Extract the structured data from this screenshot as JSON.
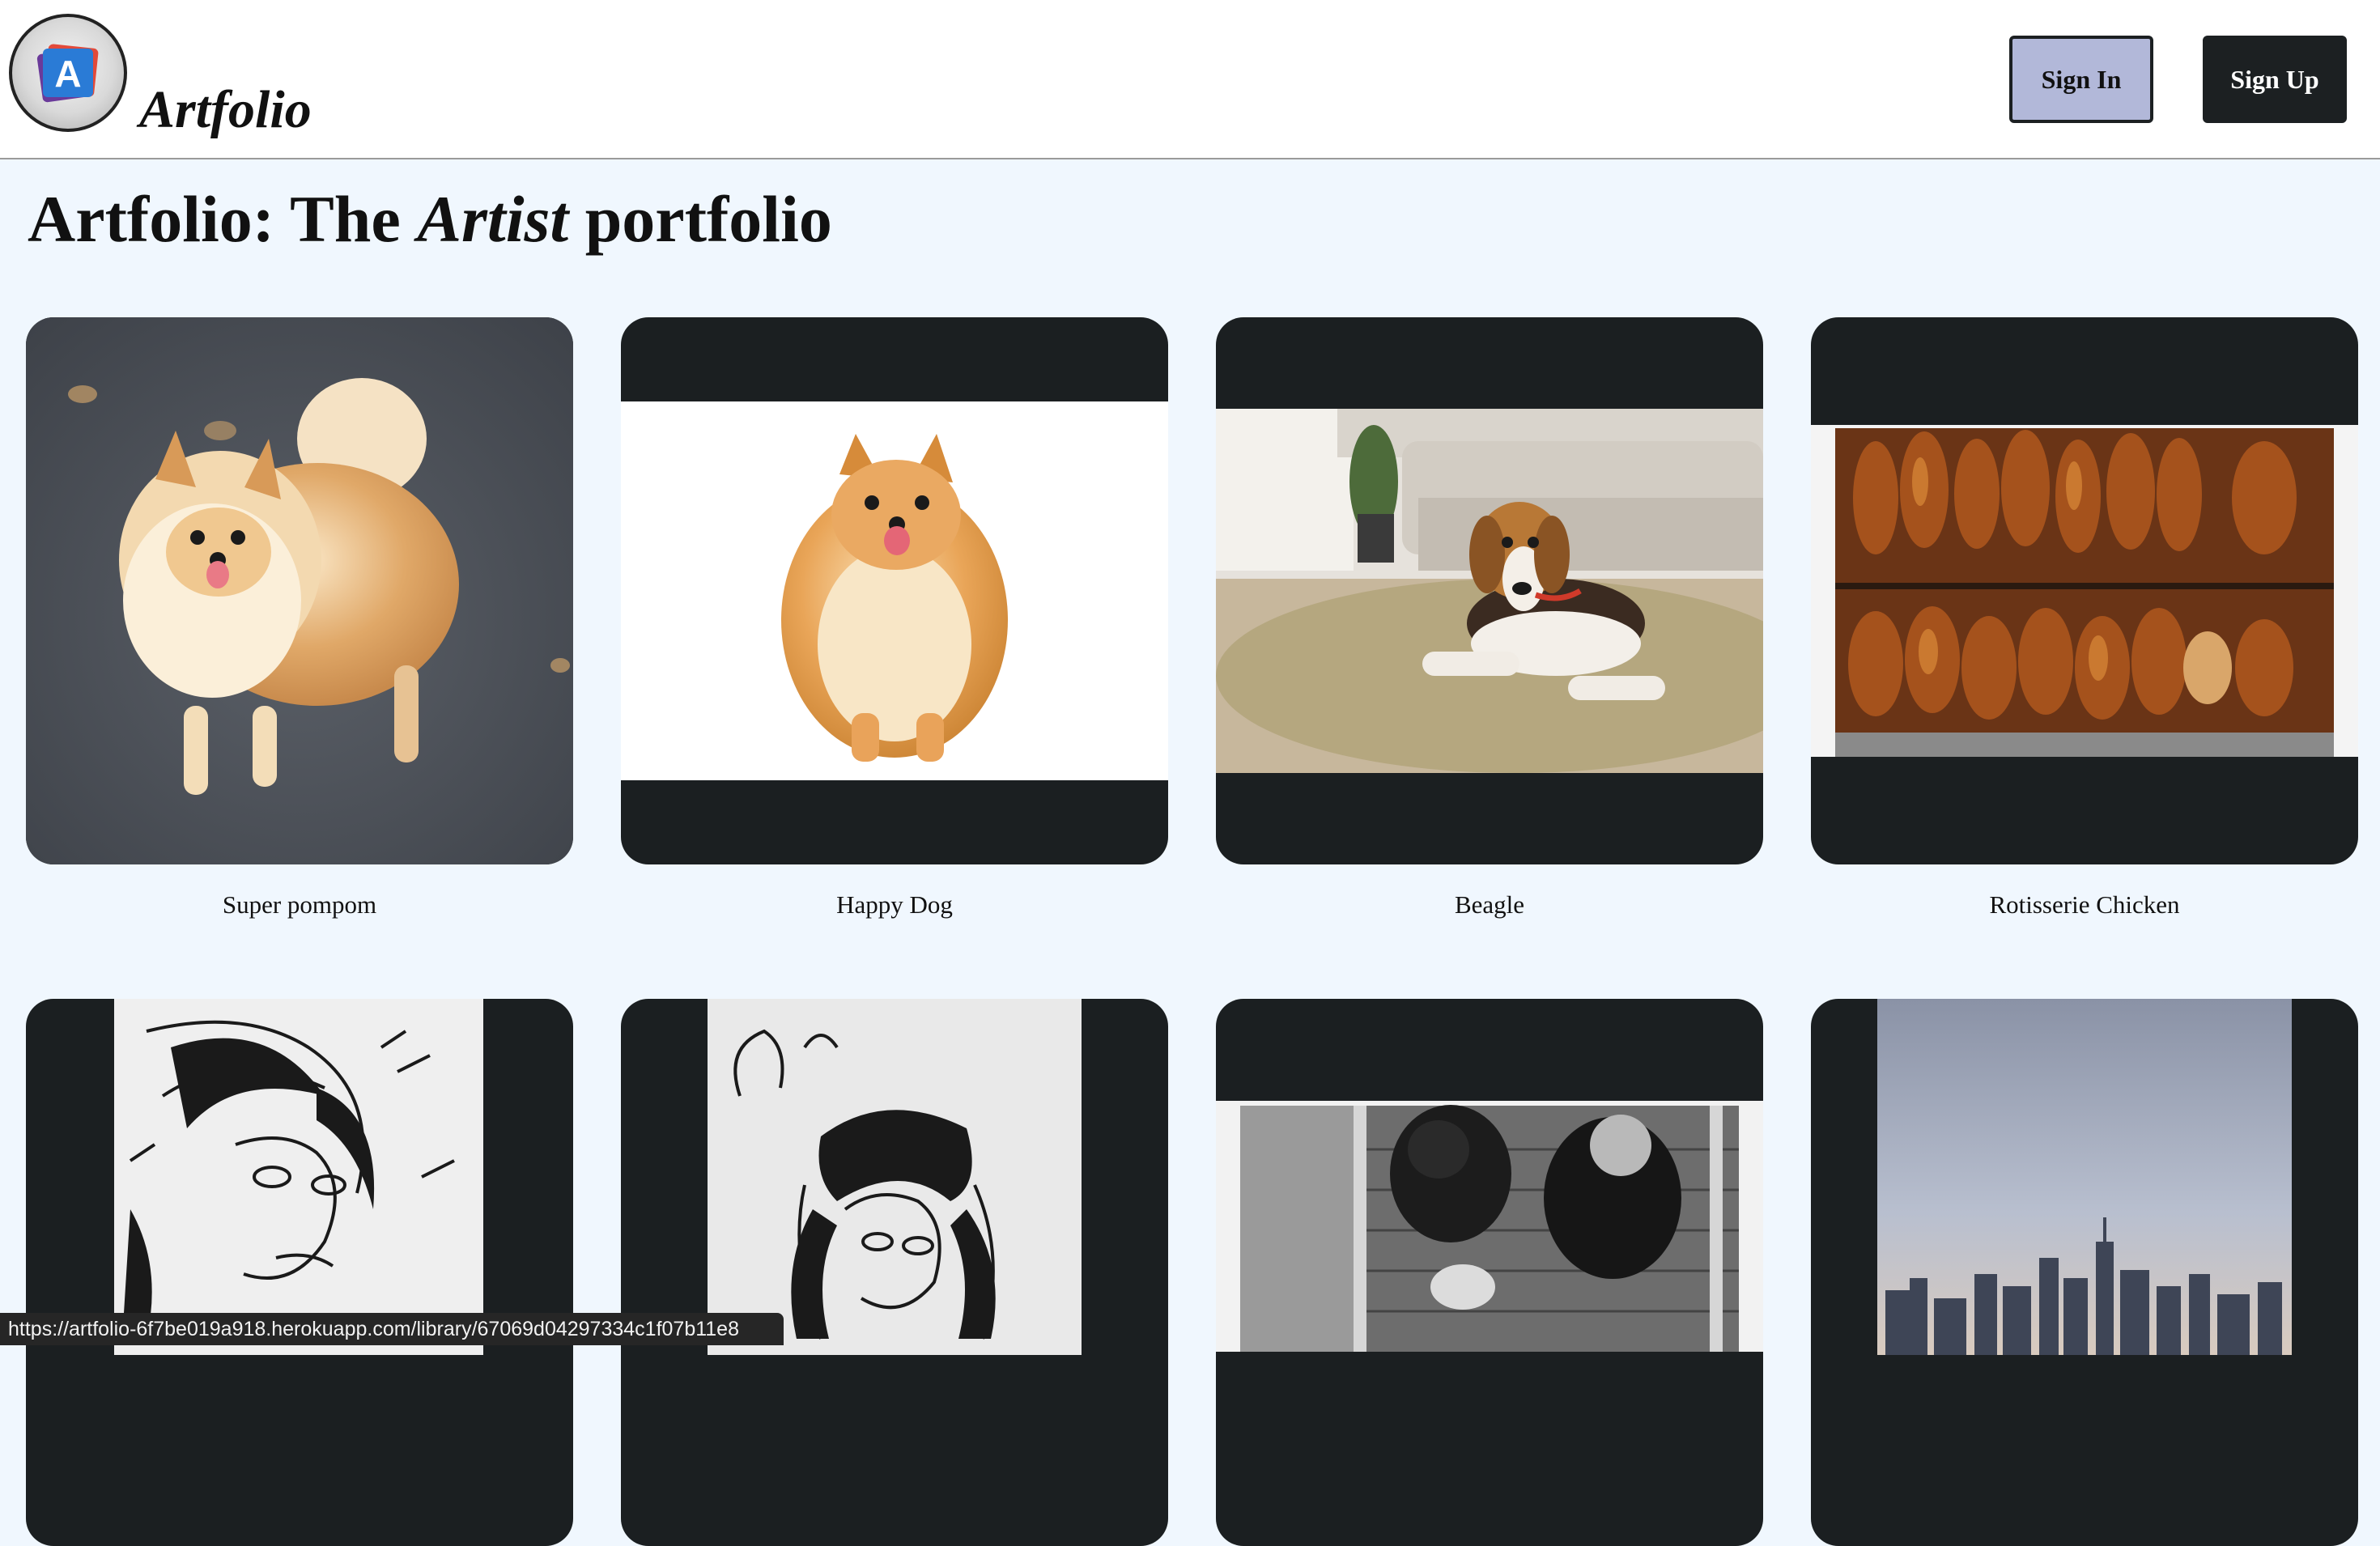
{
  "header": {
    "brand": "Artfolio",
    "logo_letter": "A",
    "signin_label": "Sign In",
    "signup_label": "Sign Up"
  },
  "hero": {
    "title_start": "Artfolio: The ",
    "title_em": "Artist",
    "title_end": " portfolio"
  },
  "gallery": [
    {
      "caption": "Super pompom",
      "image": "pomeranian on asphalt"
    },
    {
      "caption": "Happy Dog",
      "image": "pomeranian on white background"
    },
    {
      "caption": "Beagle",
      "image": "beagle lying on rug"
    },
    {
      "caption": "Rotisserie Chicken",
      "image": "roast chickens in shop window"
    },
    {
      "caption": "",
      "image": "ink drawing of face"
    },
    {
      "caption": "",
      "image": "ink drawing of person holding head"
    },
    {
      "caption": "",
      "image": "black and white photo of people on stairs"
    },
    {
      "caption": "",
      "image": "city skyline at dusk"
    }
  ],
  "status_url": "https://artfolio-6f7be019a918.herokuapp.com/library/67069d04297334c1f07b11e8",
  "colors": {
    "page_bg": "#f0f7fe",
    "card_bg": "#1b1f21",
    "signin_bg": "#b2b8d9",
    "signup_bg": "#1c2022"
  }
}
